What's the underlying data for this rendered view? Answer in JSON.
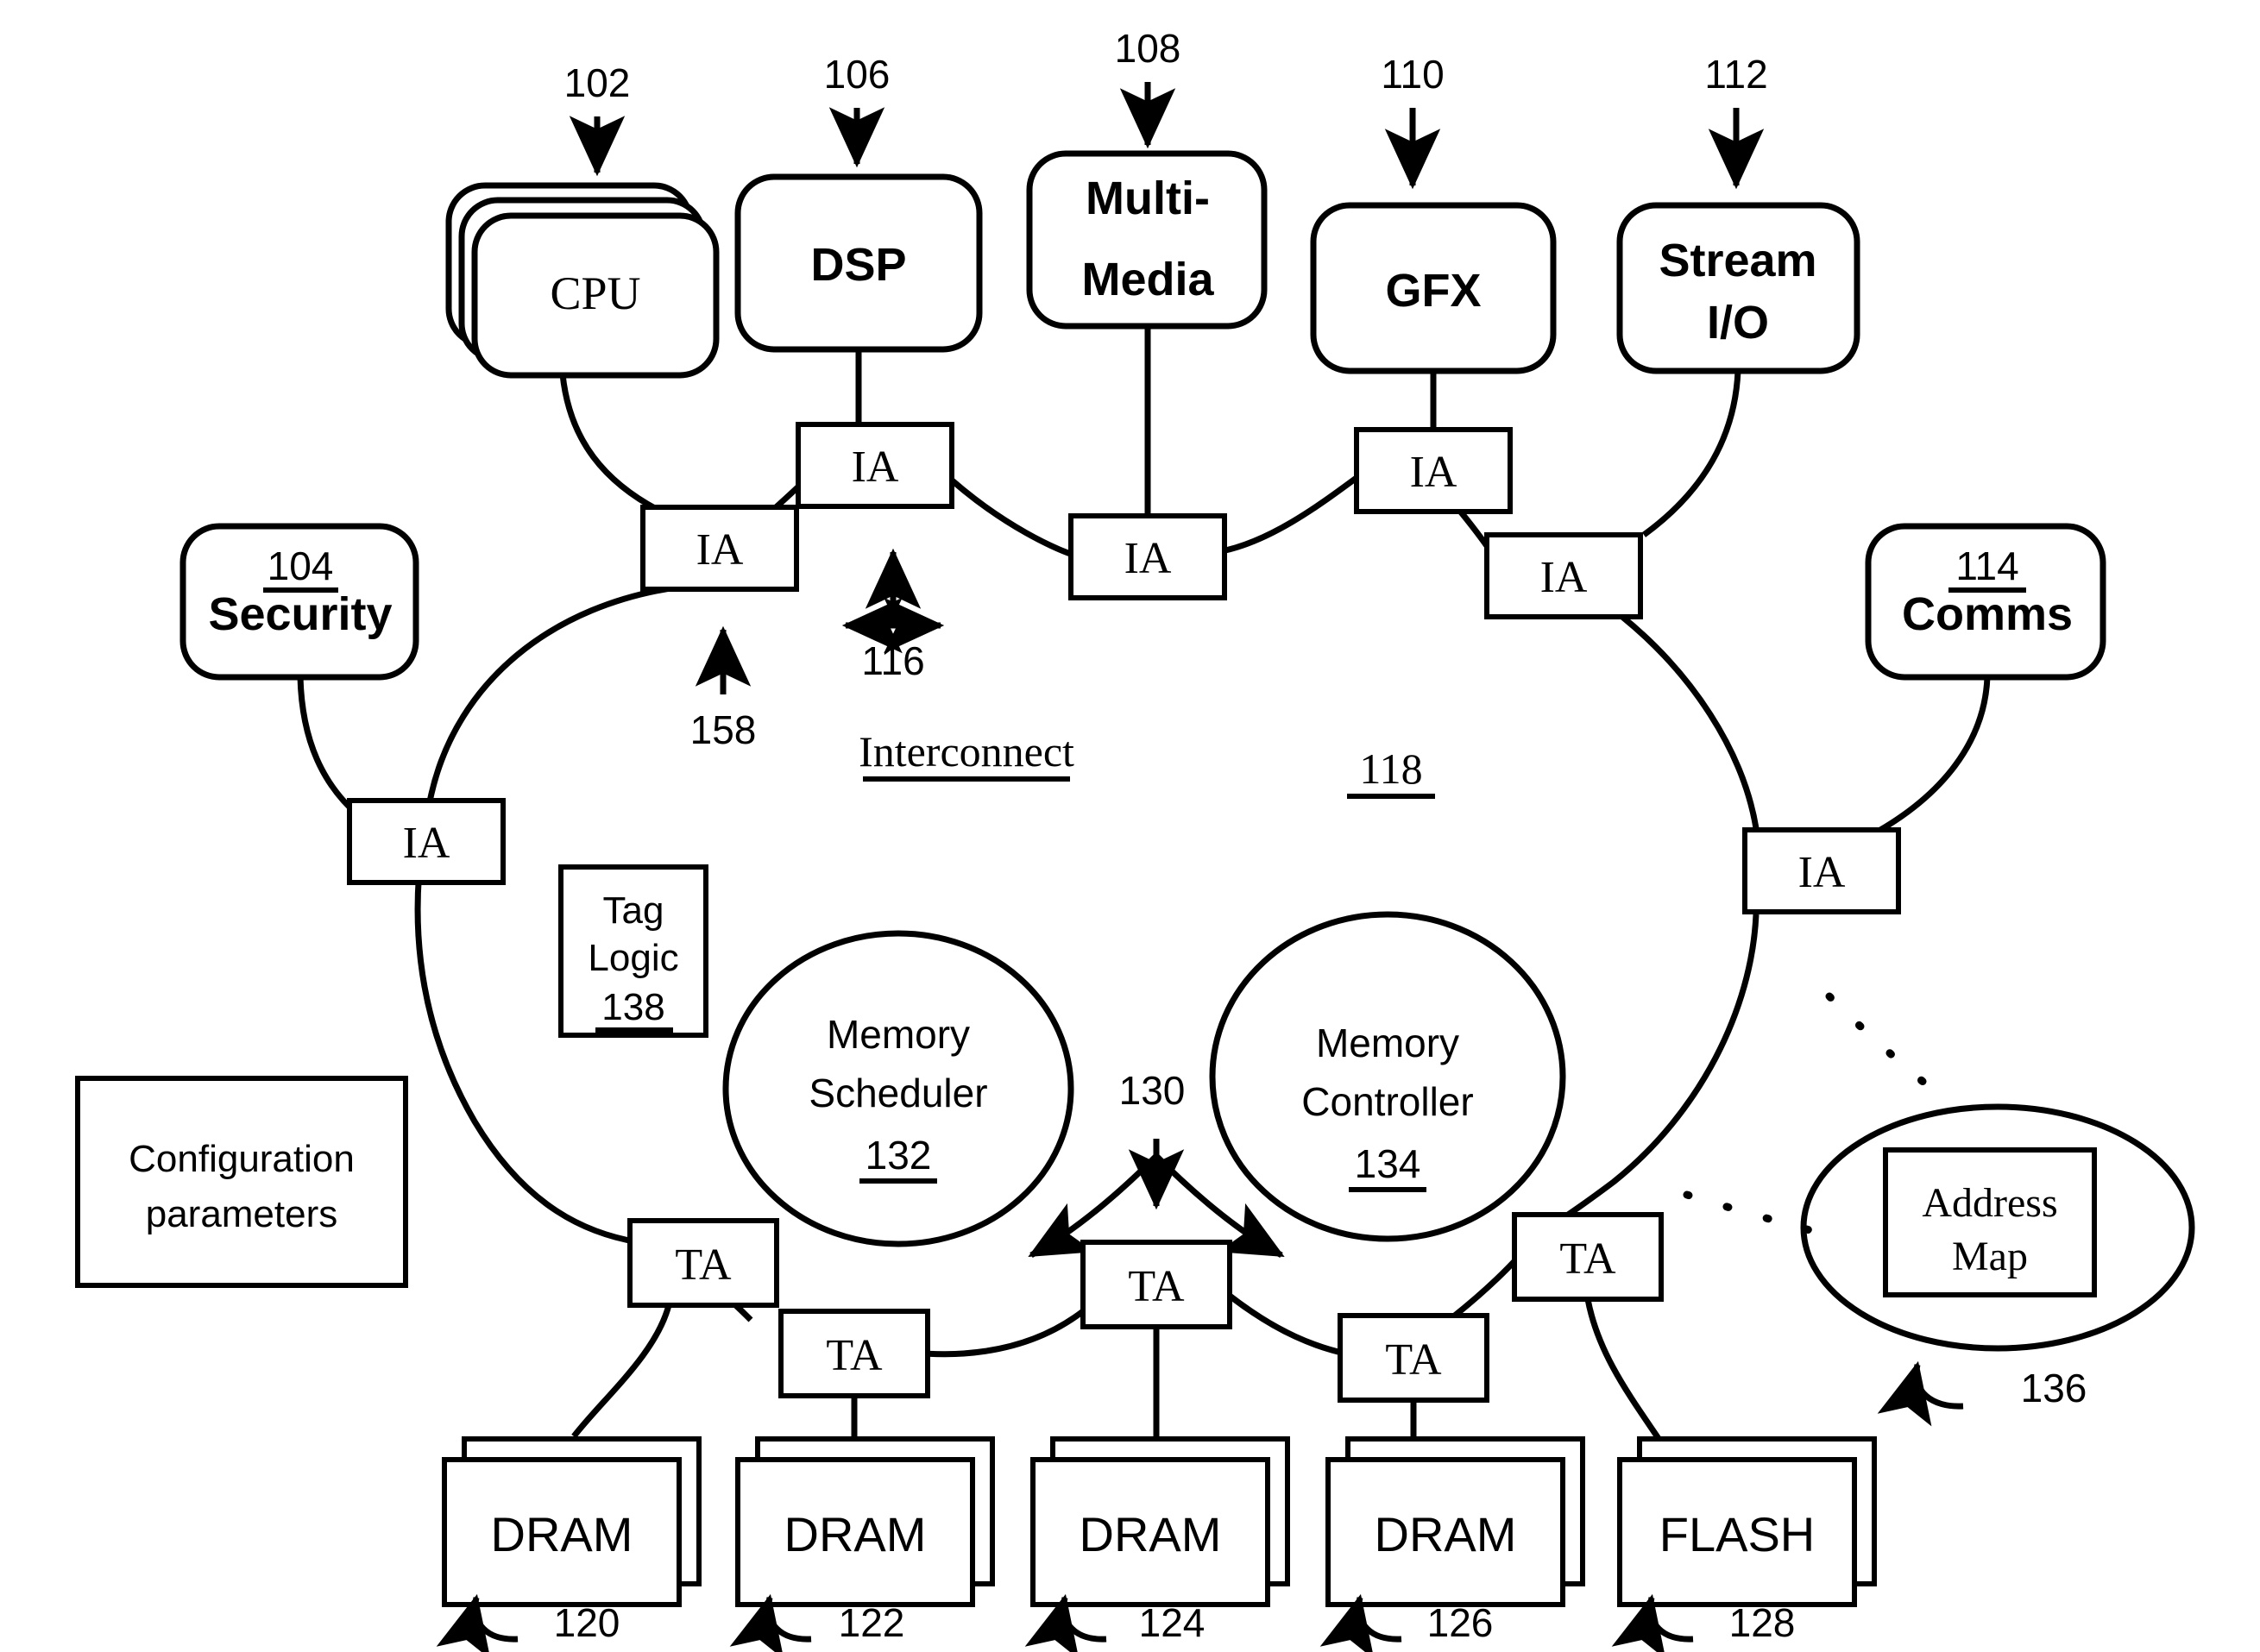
{
  "figure": {
    "type": "patent-block-diagram",
    "title_label": "Interconnect",
    "title_ref": "118"
  },
  "top_blocks": [
    {
      "id": "cpu",
      "label": "CPU",
      "ref": "102",
      "style": "stacked-rounded",
      "font": "serif"
    },
    {
      "id": "dsp",
      "label": "DSP",
      "ref": "106",
      "style": "rounded",
      "font": "bold-sans"
    },
    {
      "id": "mm",
      "label_line1": "Multi-",
      "label_line2": "Media",
      "ref": "108",
      "style": "rounded",
      "font": "bold-sans"
    },
    {
      "id": "gfx",
      "label": "GFX",
      "ref": "110",
      "style": "rounded",
      "font": "bold-sans"
    },
    {
      "id": "stream",
      "label_line1": "Stream",
      "label_line2": "I/O",
      "ref": "112",
      "style": "rounded",
      "font": "bold-sans"
    }
  ],
  "side_blocks": [
    {
      "id": "security",
      "ref": "104",
      "label": "Security",
      "font": "bold-sans"
    },
    {
      "id": "comms",
      "ref": "114",
      "label": "Comms",
      "font": "bold-sans"
    }
  ],
  "ia_agents": {
    "label": "IA",
    "count": 7,
    "description": "Initiator Agent boxes attached to the interconnect ring"
  },
  "ta_agents": {
    "label": "TA",
    "count": 5,
    "description": "Target Agent boxes attached to the interconnect ring"
  },
  "markers": [
    {
      "id": "m116",
      "ref": "116",
      "kind": "tri-arrow",
      "note": "interconnect link marker"
    },
    {
      "id": "m158",
      "ref": "158",
      "kind": "up-arrow",
      "note": "initiator agent marker"
    },
    {
      "id": "m130",
      "ref": "130",
      "kind": "fan-arrow",
      "note": "target agent marker"
    },
    {
      "id": "m136",
      "ref": "136",
      "kind": "hook-arrow",
      "note": "address map marker"
    }
  ],
  "circles": [
    {
      "id": "memsched",
      "line1": "Memory",
      "line2": "Scheduler",
      "ref": "132"
    },
    {
      "id": "memctrl",
      "line1": "Memory",
      "line2": "Controller",
      "ref": "134"
    }
  ],
  "tag_logic": {
    "line1": "Tag",
    "line2": "Logic",
    "ref": "138"
  },
  "config_box": {
    "line1": "Configuration",
    "line2": "parameters"
  },
  "address_map": {
    "line1": "Address",
    "line2": "Map",
    "ref": "136"
  },
  "memories": [
    {
      "id": "mem120",
      "label": "DRAM",
      "ref": "120"
    },
    {
      "id": "mem122",
      "label": "DRAM",
      "ref": "122"
    },
    {
      "id": "mem124",
      "label": "DRAM",
      "ref": "124"
    },
    {
      "id": "mem126",
      "label": "DRAM",
      "ref": "126"
    },
    {
      "id": "mem128",
      "label": "FLASH",
      "ref": "128"
    }
  ],
  "colors": {
    "ink": "#000000",
    "paper": "#ffffff"
  }
}
